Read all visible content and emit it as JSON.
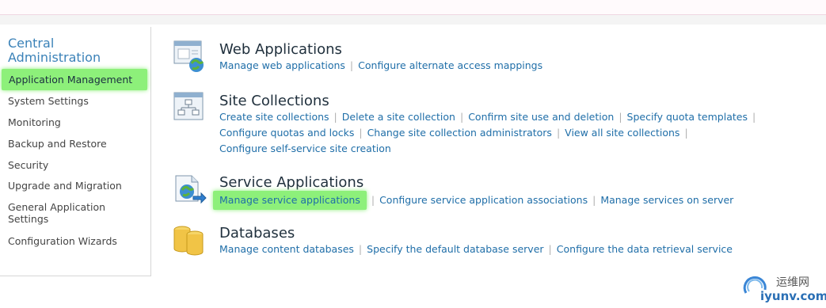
{
  "site_title": "Central Administration",
  "nav": [
    {
      "label": "Application Management",
      "selected": true
    },
    {
      "label": "System Settings"
    },
    {
      "label": "Monitoring"
    },
    {
      "label": "Backup and Restore"
    },
    {
      "label": "Security"
    },
    {
      "label": "Upgrade and Migration"
    },
    {
      "label": "General Application Settings"
    },
    {
      "label": "Configuration Wizards"
    }
  ],
  "sections": {
    "web_apps": {
      "title": "Web Applications",
      "icon": "web-applications-icon",
      "links": [
        "Manage web applications",
        "Configure alternate access mappings"
      ]
    },
    "site_collections": {
      "title": "Site Collections",
      "icon": "site-collections-icon",
      "links": [
        "Create site collections",
        "Delete a site collection",
        "Confirm site use and deletion",
        "Specify quota templates",
        "Configure quotas and locks",
        "Change site collection administrators",
        "View all site collections",
        "Configure self-service site creation"
      ]
    },
    "service_apps": {
      "title": "Service Applications",
      "icon": "service-applications-icon",
      "links": [
        "Manage service applications",
        "Configure service application associations",
        "Manage services on server"
      ]
    },
    "databases": {
      "title": "Databases",
      "icon": "databases-icon",
      "links": [
        "Manage content databases",
        "Specify the default database server",
        "Configure the data retrieval service"
      ]
    }
  },
  "watermark": {
    "cn": "运维网",
    "url": "iyunv.com"
  },
  "colors": {
    "link": "#1f6ea8",
    "highlight": "#8df07a",
    "title": "#3b82b8"
  }
}
